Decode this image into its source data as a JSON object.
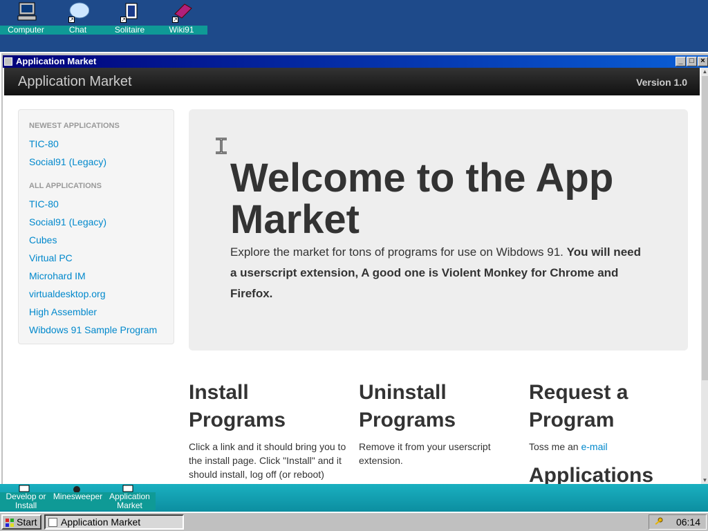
{
  "desktop": {
    "icons": [
      {
        "label": "Computer",
        "icon": "computer-icon"
      },
      {
        "label": "Chat",
        "icon": "chat-icon"
      },
      {
        "label": "Solitaire",
        "icon": "solitaire-icon"
      },
      {
        "label": "Wiki91",
        "icon": "wiki-icon"
      }
    ]
  },
  "window": {
    "title": "Application Market",
    "minimize": "_",
    "maximize": "□",
    "close": "×"
  },
  "navbar": {
    "brand": "Application Market",
    "version": "Version 1.0"
  },
  "sidebar": {
    "newest_header": "NEWEST APPLICATIONS",
    "newest": [
      "TIC-80",
      "Social91 (Legacy)"
    ],
    "all_header": "ALL APPLICATIONS",
    "all": [
      "TIC-80",
      "Social91 (Legacy)",
      "Cubes",
      "Virtual PC",
      "Microhard IM",
      "virtualdesktop.org",
      "High Assembler",
      "Wibdows 91 Sample Program"
    ]
  },
  "hero": {
    "heading": "Welcome to the App Market",
    "text": "Explore the market for tons of programs for use on Wibdows 91.",
    "bold_text": "You will need a userscript extension, A good one is Violent Monkey for Chrome and Firefox."
  },
  "columns": {
    "install": {
      "title": "Install Programs",
      "text": "Click a link and it should bring you to the install page. Click \"Install\" and it should install, log off (or reboot)"
    },
    "uninstall": {
      "title": "Uninstall Programs",
      "text": "Remove it from your userscript extension."
    },
    "request": {
      "title": "Request a Program",
      "text": "Toss me an",
      "link": "e-mail",
      "next_heading": "Applications"
    }
  },
  "quickbar": {
    "items": [
      {
        "label": "Develop or Install"
      },
      {
        "label": "Minesweeper"
      },
      {
        "label": "Application Market"
      }
    ]
  },
  "taskbar": {
    "start": "Start",
    "task": "Application Market",
    "clock": "06:14"
  }
}
